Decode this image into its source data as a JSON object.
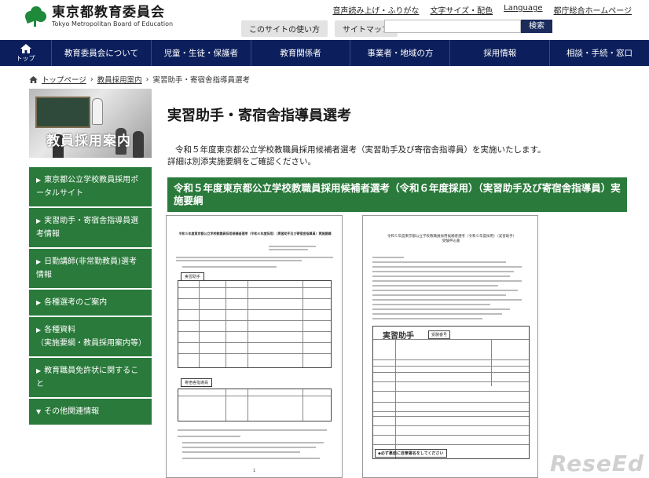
{
  "header": {
    "org_title": "東京都教育委員会",
    "org_sub": "Tokyo Metropolitan Board of Education",
    "util_links": [
      "音声読み上げ・ふりがな",
      "文字サイズ・配色",
      "Language",
      "都庁総合ホームページ"
    ],
    "pill_usage": "このサイトの使い方",
    "pill_sitemap": "サイトマップ",
    "search_button": "検索",
    "search_placeholder": ""
  },
  "nav": {
    "home_label": "トップ",
    "items": [
      "教育委員会について",
      "児童・生徒・保護者",
      "教育関係者",
      "事業者・地域の方",
      "採用情報",
      "相談・手続・窓口"
    ]
  },
  "breadcrumb": [
    "トップページ",
    "教員採用案内",
    "実習助手・寄宿舎指導員選考"
  ],
  "sidebar": {
    "banner_title": "教員採用案内",
    "items": [
      "東京都公立学校教員採用ポータルサイト",
      "実習助手・寄宿舎指導員選考情報",
      "日勤講師(非常勤教員)選考情報",
      "各種選考のご案内",
      "各種資料\n（実施要綱・教員採用案内等）",
      "教育職員免許状に関すること",
      "その他関連情報"
    ],
    "last_marker": "▼"
  },
  "main": {
    "title": "実習助手・寄宿舎指導員選考",
    "intro_line1": "令和５年度東京都公立学校教職員採用候補者選考（実習助手及び寄宿舎指導員）を実施いたします。",
    "intro_line2": "詳細は別添実施要綱をご確認ください。",
    "section_heading": "令和５年度東京都公立学校教職員採用候補者選考（令和６年度採用）（実習助手及び寄宿舎指導員）実施要綱"
  },
  "doc1": {
    "heading": "令和５年度東京都公立学校教職員採用候補者選考（令和６年度採用）（実習助手及び寄宿舎指導員）実施要綱",
    "tag1": "実習助手",
    "tag2": "寄宿舎指導員",
    "page_no": "1"
  },
  "doc2": {
    "heading": "令和５年度東京都公立学校教職員採用候補者選考（令和６年度採用）（実習助手）受験申込書",
    "form_title": "実習助手",
    "exam_no_label": "受験番号",
    "footer_note": "◆必ず裏面に自筆署名をしてください"
  },
  "watermark": "ReseEd"
}
